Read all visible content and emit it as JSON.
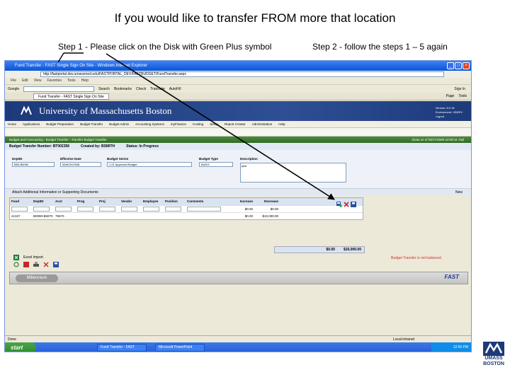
{
  "slide": {
    "title": "If you would like to transfer FROM more that location",
    "step1": "Step 1 - Please click on the Disk with Green Plus symbol",
    "step2": "Step 2 -  follow the steps  1 – 5 again"
  },
  "browser": {
    "window_title": "Fund Transfer - FAST Single Sign On Site - Windows Internet Explorer",
    "address": "http://fastportal.dev.umassmed.edu/FASTPORTAL_DEV/FASTBUDGET/FundTransfer.aspx",
    "menu": [
      "File",
      "Edit",
      "View",
      "Favorites",
      "Tools",
      "Help"
    ],
    "google_label": "Google",
    "google_tools": [
      "Search",
      "Bookmarks",
      "Check",
      "Translate",
      "AutoFill"
    ],
    "sign_in": "Sign In",
    "tab_title": "Fund Transfer - FAST Single Sign On Site",
    "tab_tools": [
      "Page",
      "Tools"
    ]
  },
  "banner": {
    "title": "University of Massachusetts Boston",
    "version_label": "Version:",
    "version_value": "8.0.18",
    "env_label": "Environment:",
    "env_value": "VBDEV",
    "logout": "Logout"
  },
  "app_menu": [
    "Home",
    "Applications",
    "Budget Preparation",
    "Budget Transfer",
    "Budget Admin",
    "Accounting Systems",
    "myFinance",
    "Costing",
    "Setup",
    "Report Creator",
    "Administration",
    "Help"
  ],
  "breadcrumb": {
    "path": "Budget and Forecasting › Budget Transfer › Transfer Budget Transfer",
    "user_info": "(Data as of 05/17/2009 10:00:11 AM)"
  },
  "transfer_header": {
    "number_label": "Budget Transfer Number:",
    "number_value": "BT002356",
    "created_label": "Created by:",
    "created_value": "BSMITH",
    "status_label": "Status:",
    "status_value": "In Progress"
  },
  "fields": {
    "deptid_label": "DeptID",
    "deptid_value": "B50-B0050",
    "effdate_label": "Effective Date",
    "effdate_value": "05/NOV/2008",
    "series_label": "Budget Series",
    "series_value": "1.01 Approved Budget",
    "type_label": "Budget Type",
    "type_value": "BUDG",
    "description_label": "Description",
    "description_value": "pilot"
  },
  "attach": {
    "label": "Attach Additional Information or Supporting Documents",
    "new_label": "New"
  },
  "grid": {
    "columns": [
      "Fund",
      "DeptID",
      "Acct",
      "Prog",
      "Proj",
      "Vendor",
      "Employee",
      "Position",
      "Comments",
      "Increase",
      "Decrease"
    ],
    "input_increase": "$0.00",
    "input_decrease": "$0.00",
    "row1": [
      "41327",
      "B0090-B5070",
      "75570",
      "",
      "",
      "",
      "",
      "",
      "",
      "$0.00",
      "$10,000.00"
    ]
  },
  "totals": {
    "increase": "$0.00",
    "decrease": "$10,000.00"
  },
  "warning": "Budget Transfer is not balanced.",
  "bottom": {
    "excel_import": "Excel Import",
    "save_label": "Save"
  },
  "footer": {
    "millennium": "Millennium",
    "fast_brand": "FAST"
  },
  "status_bar": {
    "left": "Done",
    "right": "Local intranet"
  },
  "taskbar": {
    "start": "start",
    "item1": "Fund Transfer - FAST",
    "item2": "Microsoft PowerPoint",
    "clock": "12:56 PM"
  },
  "brand": {
    "line1": "UMASS",
    "line2": "BOSTON"
  },
  "colors": {
    "banner": "#1d3a7a",
    "green_bar": "#2f6b24",
    "warning": "#d32f2f",
    "taskbar": "#245edb"
  }
}
